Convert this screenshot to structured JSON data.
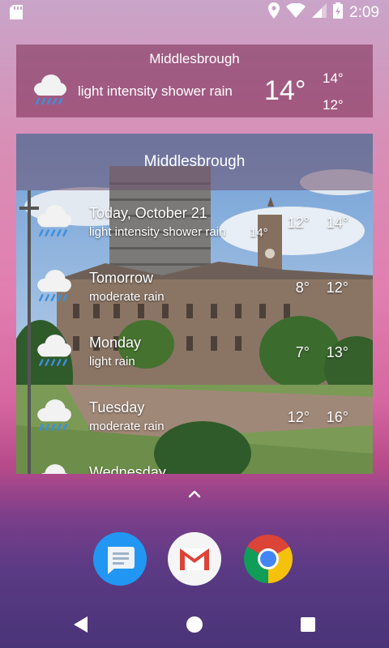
{
  "status_bar": {
    "time": "2:09"
  },
  "current": {
    "city": "Middlesbrough",
    "description": "light intensity shower rain",
    "temp": "14°",
    "high": "14°",
    "low": "12°"
  },
  "forecast": {
    "city": "Middlesbrough",
    "rows": [
      {
        "day": "Today, October 21",
        "desc": "light intensity shower rain",
        "now": "14°",
        "low": "12°",
        "high": "14°"
      },
      {
        "day": "Tomorrow",
        "desc": "moderate rain",
        "low": "8°",
        "high": "12°"
      },
      {
        "day": "Monday",
        "desc": "light rain",
        "low": "7°",
        "high": "13°"
      },
      {
        "day": "Tuesday",
        "desc": "moderate rain",
        "low": "12°",
        "high": "16°"
      },
      {
        "day": "Wednesday"
      }
    ]
  },
  "dock": [
    "messages-app-icon",
    "gmail-app-icon",
    "chrome-app-icon"
  ],
  "colors": {
    "rain": "#3b8fe0",
    "chrome_red": "#db4437",
    "chrome_yellow": "#f4c20d",
    "chrome_green": "#0f9d58",
    "chrome_blue": "#4285f4",
    "messages_blue": "#2196f3"
  }
}
